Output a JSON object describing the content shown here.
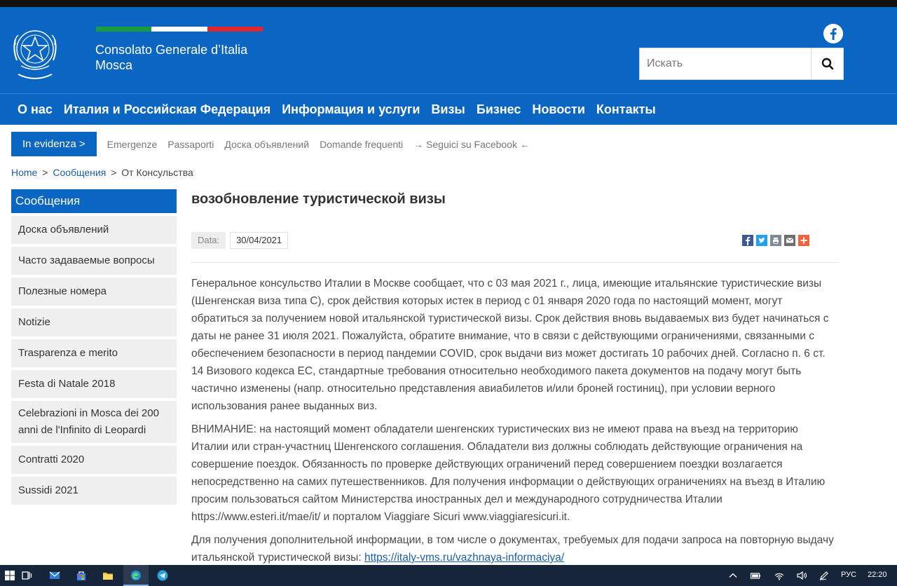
{
  "header": {
    "site_title_line1": "Consolato Generale d’Italia",
    "site_title_line2": "Mosca",
    "emblem_text": "REPUBBLICA ITALIANA",
    "search_placeholder": "Искать",
    "flag_colors": [
      "#1a9b3c",
      "#ffffff",
      "#e0262b"
    ],
    "accent": "#0a66c2"
  },
  "nav": {
    "items": [
      "О нас",
      "Италия и Российская Федерация",
      "Информация и услуги",
      "Визы",
      "Бизнес",
      "Новости",
      "Контакты"
    ]
  },
  "subnav": {
    "highlight": "In evidenza >",
    "links": [
      "Emergenze",
      "Passaporti",
      "Доска объявлений",
      "Domande frequenti",
      "→ Seguici su Facebook ←"
    ]
  },
  "breadcrumb": {
    "home": "Home",
    "section": "Сообщения",
    "sep": ">",
    "current": "От Консульства"
  },
  "sidebar": {
    "title": "Сообщения",
    "items": [
      "Доска объявлений",
      "Часто задаваемые вопросы",
      "Полезные номера",
      "Notizie",
      "Trasparenza e merito",
      "Festa di Natale 2018",
      "Celebrazioni in Mosca dei 200 anni de l'Infinito di Leopardi",
      "Contratti 2020",
      "Sussidi 2021"
    ]
  },
  "article": {
    "title": "возобновление туристической визы",
    "date_label": "Data:",
    "date_value": "30/04/2021",
    "p1": "Генеральное консульство Италии в Москве сообщает, что с 03 мая 2021 г., лица, имеющие итальянские туристические визы (Шенгенская виза типа С), срок действия которых истек в период с 01 января 2020 года по настоящий момент, могут обратиться за получением новой итальянской туристической визы. Срок действия вновь выдаваемых виз будет начинаться с даты не ранее 31 июля 2021. Пожалуйста, обратите внимание, что в связи с действующими ограничениями, связанными с обеспечением безопасности в период пандемии COVID, срок выдачи виз может достигать 10 рабочих дней. Согласно п. 6 ст. 14 Визового кодекса ЕС, стандартные требования относительно необходимого пакета документов на подачу могут быть частично изменены (напр. относительно представления авиабилетов и/или броней гостиниц), при условии верного использования ранее выданных виз.",
    "p2": "ВНИМАНИЕ: на настоящий момент обладатели шенгенских туристических виз не имеют права на въезд на территорию Италии или стран-участниц Шенгенского соглашения. Обладатели виз должны соблюдать действующие ограничения на совершение поездок. Обязанность по проверке действующих ограничений перед совершением поездки возлагается непосредственно на самих путешественников. Для получения информации о действующих ограничениях на въезд в Италию просим пользоваться сайтом Министерства иностранных дел и международного сотрудничества Италии https://www.esteri.it/mae/it/ и порталом Viaggiare Sicuri www.viaggiaresicuri.it.",
    "p3_text": "Для получения дополнительной информации, в том числе о документах, требуемых для подачи запроса на повторную выдачу итальянской туристической визы:",
    "p3_link": "https://italy-vms.ru/vazhnaya-informaciya/"
  },
  "share_icons": [
    "facebook-icon",
    "twitter-icon",
    "print-icon",
    "email-icon",
    "plus-icon"
  ],
  "taskbar": {
    "language": "РУС",
    "time": "22:20"
  }
}
